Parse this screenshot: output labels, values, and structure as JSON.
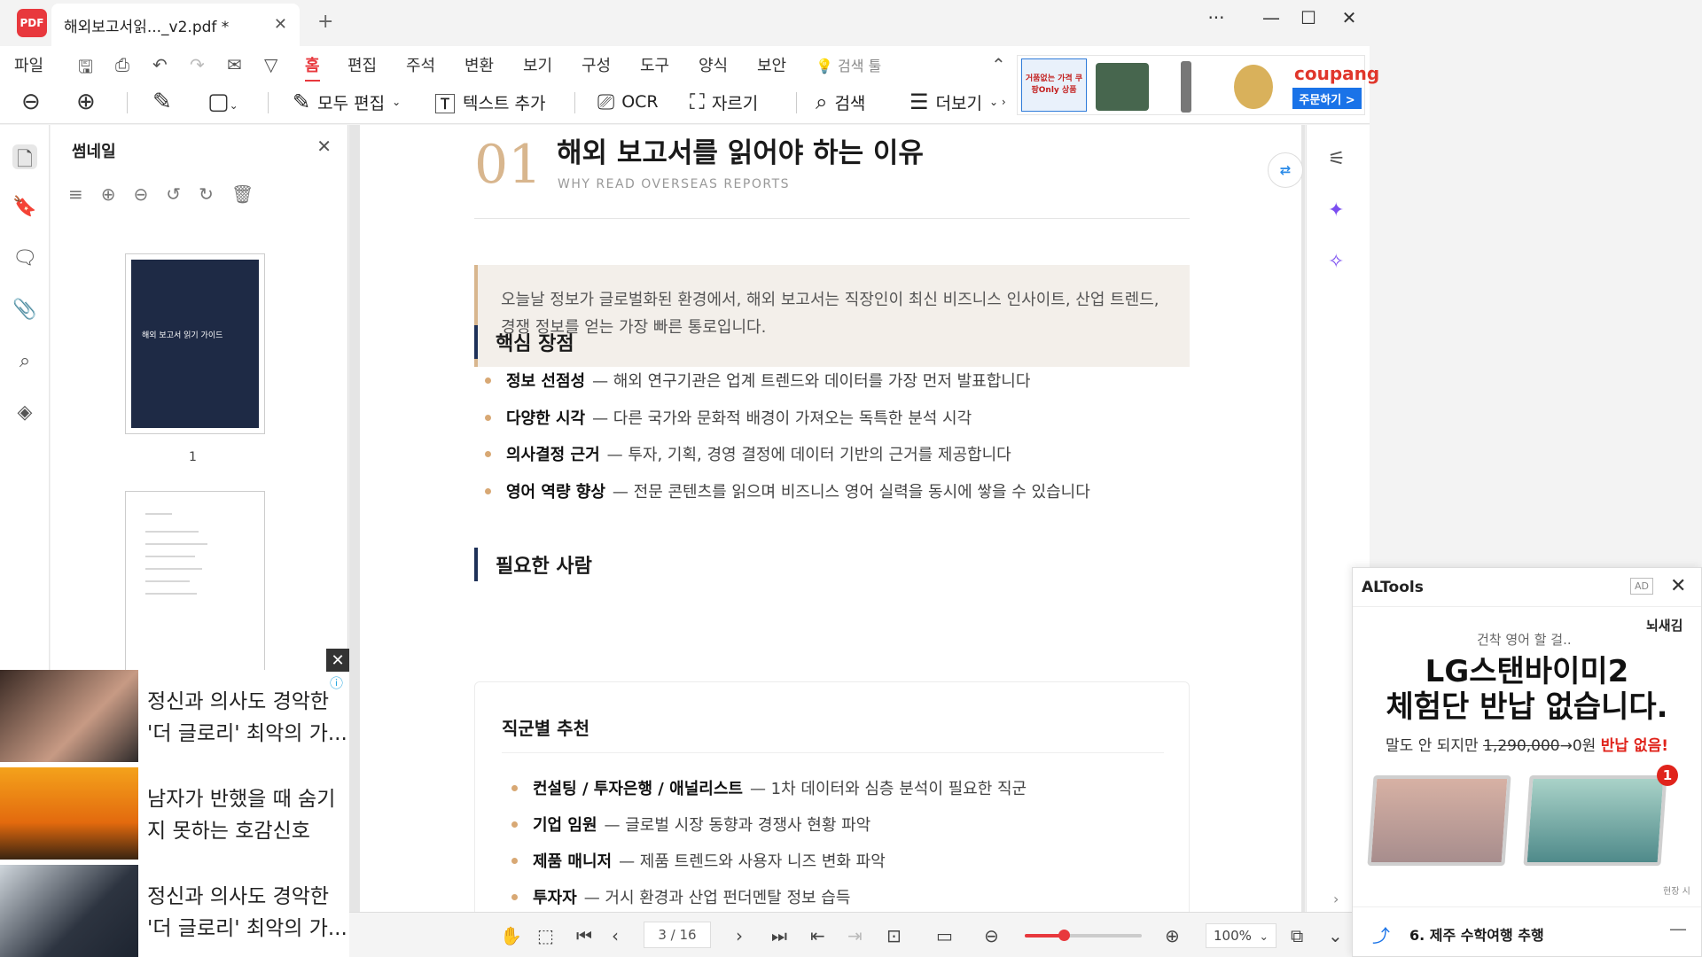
{
  "app": {
    "logo": "PDF",
    "tab_title": "해외보고서읽..._v2.pdf *",
    "tab_close": "✕",
    "new_tab": "+",
    "window_more": "···",
    "window_min": "—",
    "window_max": "☐",
    "window_close": "✕"
  },
  "menu": {
    "items": [
      "파일",
      "홈",
      "편집",
      "주석",
      "변환",
      "보기",
      "구성",
      "도구",
      "양식",
      "보안"
    ],
    "active": "홈",
    "search_tool": "검색 툴"
  },
  "toolbar": {
    "edit_all": "모두 편집",
    "add_text": "텍스트 추가",
    "ocr": "OCR",
    "crop": "자르기",
    "search": "검색",
    "more": "더보기"
  },
  "top_ad": {
    "panel_text": "거품없는 가격 쿠팡Only 상품",
    "brand": "coupang",
    "order_button": "주문하기 >"
  },
  "thumbnails": {
    "title": "썸네일",
    "page1_cover_title": "해외 보고서 읽기 가이드",
    "page1_label": "1"
  },
  "feed_ads": [
    {
      "text": "정신과 의사도 경악한 '더 글로리' 최악의 가..."
    },
    {
      "text": "남자가 반했을 때 숨기지 못하는 호감신호"
    },
    {
      "text": "정신과 의사도 경악한 '더 글로리' 최악의 가..."
    }
  ],
  "document": {
    "chapter_number": "01",
    "chapter_title": "해외 보고서를 읽어야 하는 이유",
    "chapter_subtitle": "WHY READ OVERSEAS REPORTS",
    "intro": "오늘날 정보가 글로벌화된 환경에서, 해외 보고서는 직장인이 최신 비즈니스 인사이트, 산업 트렌드, 경쟁 정보를 얻는 가장 빠른 통로입니다.",
    "section1_title": "핵심 장점",
    "advantages": [
      {
        "term": "정보 선점성",
        "desc": "— 해외 연구기관은 업계 트렌드와 데이터를 가장 먼저 발표합니다"
      },
      {
        "term": "다양한 시각",
        "desc": "— 다른 국가와 문화적 배경이 가져오는 독특한 분석 시각"
      },
      {
        "term": "의사결정 근거",
        "desc": "— 투자, 기획, 경영 결정에 데이터 기반의 근거를 제공합니다"
      },
      {
        "term": "영어 역량 향상",
        "desc": "— 전문 콘텐츠를 읽으며 비즈니스 영어 실력을 동시에 쌓을 수 있습니다"
      }
    ],
    "section2_title": "필요한 사람",
    "recommend_title": "직군별 추천",
    "recommendations": [
      {
        "term": "컨설팅 / 투자은행 / 애널리스트",
        "desc": "— 1차 데이터와 심층 분석이 필요한 직군"
      },
      {
        "term": "기업 임원",
        "desc": "— 글로벌 시장 동향과 경쟁사 현황 파악"
      },
      {
        "term": "제품 매니저",
        "desc": "— 제품 트렌드와 사용자 니즈 변화 파악"
      },
      {
        "term": "투자자",
        "desc": "— 거시 환경과 산업 펀더멘탈 정보 습득"
      }
    ]
  },
  "statusbar": {
    "page_indicator": "3 / 16",
    "zoom_level": "100%",
    "zoom_fraction": 0.33
  },
  "altools": {
    "title": "ALTools",
    "ad_badge": "AD",
    "brand": "뇌새김",
    "kicker": "건착 영어 할 걸..",
    "headline1": "LG스탠바이미2",
    "headline2": "체험단 반납 없습니다.",
    "line_prefix": "말도 안 되지만",
    "line_strike": "1,290,000",
    "line_mid": "→0원",
    "line_red": "반납 없음!",
    "badge": "1",
    "small": "현장 시",
    "footer": "6. 제주 수학여행 추행"
  },
  "colors": {
    "accent_red": "#e8383d",
    "beige_accent": "#d8b68e",
    "navy_bar": "#1e3158"
  }
}
